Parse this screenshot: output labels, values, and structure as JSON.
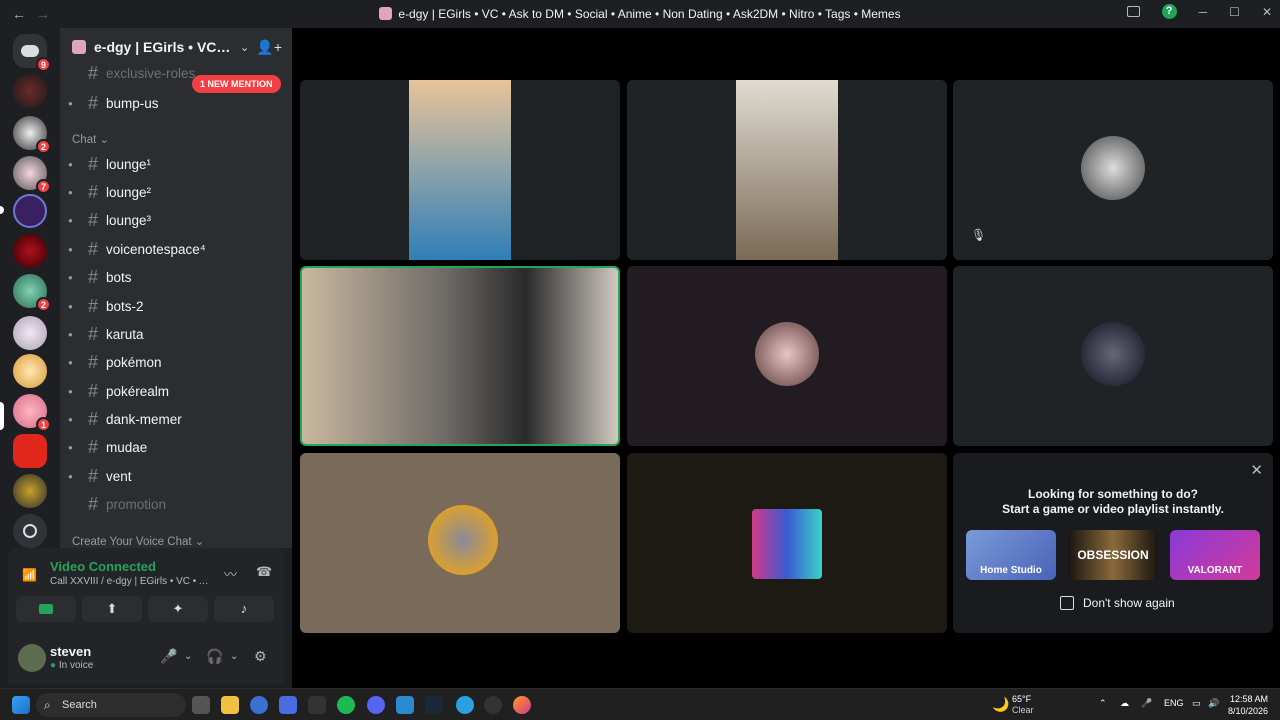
{
  "window": {
    "title": "e-dgy | EGirls • VC • Ask to DM • Social • Anime • Non Dating • Ask2DM • Nitro • Tags • Memes",
    "back": "←",
    "forward": "→",
    "controls": [
      "inbox-icon",
      "help-icon",
      "minimize",
      "maximize",
      "close"
    ],
    "help_label": "?",
    "min": "─",
    "max": "☐",
    "close": "✕"
  },
  "guilds": {
    "home_badge": "9",
    "badges": [
      "2",
      "7",
      "2",
      "1"
    ]
  },
  "server": {
    "name": "e-dgy | EGirls • VC • A...",
    "chevron": "⌄",
    "add": "👤+"
  },
  "mention_pill": "1 NEW MENTION",
  "categories": {
    "chat": "Chat ⌄",
    "voice": "Create Your Voice Chat ⌄"
  },
  "channels": [
    {
      "name": "exclusive-roles"
    },
    {
      "name": "bump-us"
    },
    {
      "name": "lounge¹"
    },
    {
      "name": "lounge²"
    },
    {
      "name": "lounge³"
    },
    {
      "name": "voicenotespace⁴"
    },
    {
      "name": "bots"
    },
    {
      "name": "bots-2"
    },
    {
      "name": "karuta"
    },
    {
      "name": "pokémon"
    },
    {
      "name": "pokérealm"
    },
    {
      "name": "dank-memer"
    },
    {
      "name": "mudae"
    },
    {
      "name": "vent"
    },
    {
      "name": "promotion"
    }
  ],
  "hash": "#",
  "voice": {
    "status": "Video Connected",
    "call": "Call XXVIII / e-dgy | EGirls • VC • As...",
    "icons": [
      "noise-suppression-icon",
      "disconnect-icon"
    ],
    "buttons": [
      "camera-icon",
      "screen-share-icon",
      "activities-icon",
      "soundboard-icon"
    ]
  },
  "user": {
    "name": "steven",
    "status": "In voice"
  },
  "activity_suggestion": {
    "title": "Looking for something to do?",
    "subtitle": "Start a game or video playlist instantly.",
    "options": [
      "Home Studio",
      "OBSESSION",
      "VALORANT"
    ],
    "checkbox_label": "Don't show again",
    "close": "✕"
  },
  "taskbar": {
    "search_placeholder": "Search",
    "weather_temp": "65°F",
    "weather_desc": "Clear",
    "language": "ENG",
    "time": "12:58 AM",
    "date": "8/10/2026"
  },
  "colors": {
    "green": "#23a559",
    "red": "#f23f43",
    "sidebar": "#2b2d31",
    "guild_rail": "#1e1f22"
  }
}
